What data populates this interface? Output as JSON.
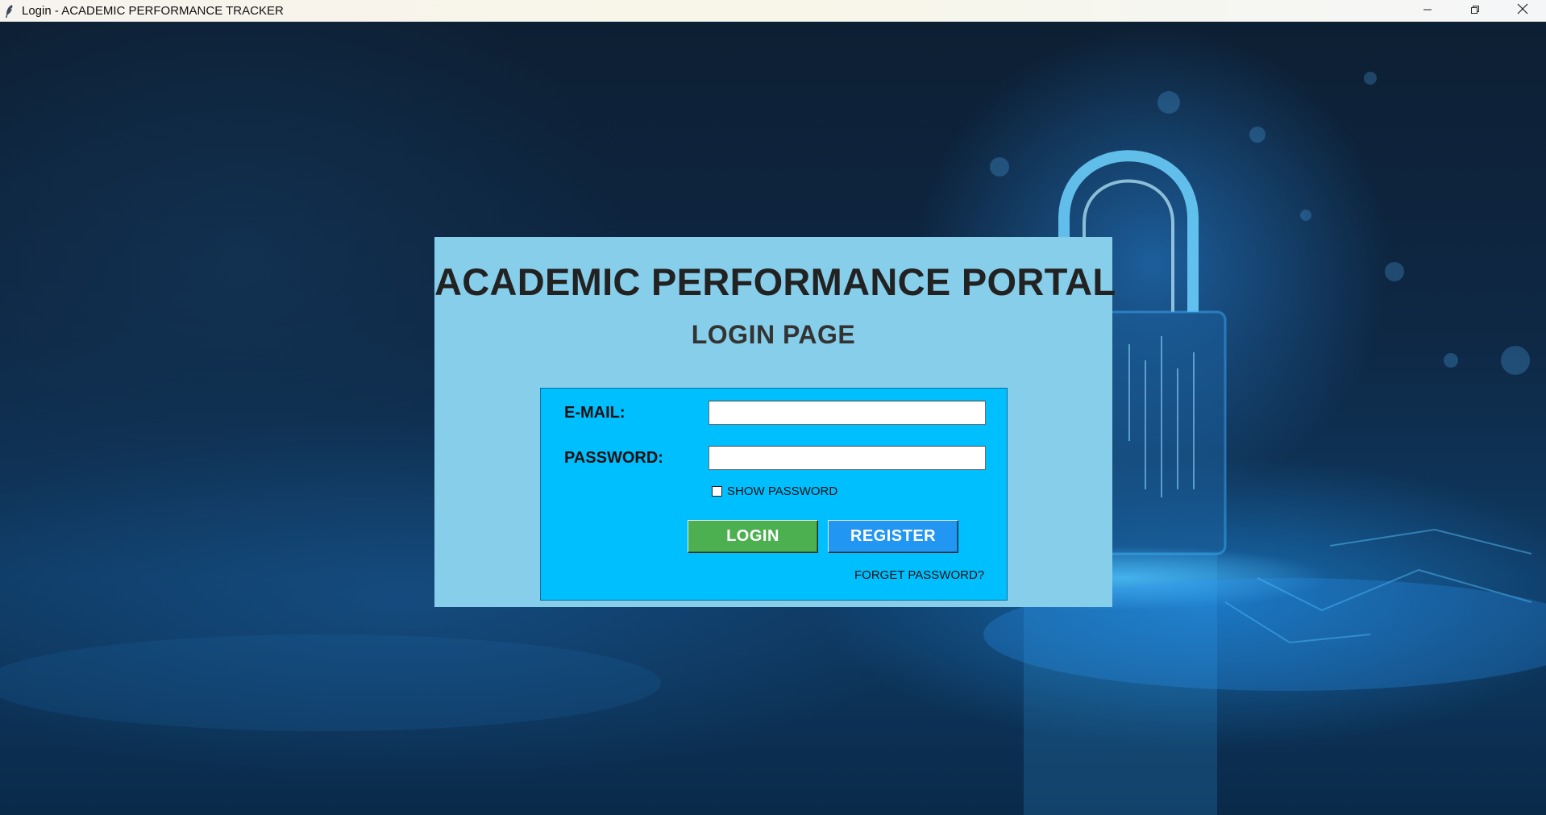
{
  "window": {
    "title": "Login - ACADEMIC PERFORMANCE TRACKER"
  },
  "icons": {
    "app": "feather-icon",
    "minimize": "minimize-icon",
    "restore": "restore-icon",
    "close": "close-icon",
    "background": "padlock-icon"
  },
  "card": {
    "title": "ACADEMIC PERFORMANCE PORTAL",
    "subtitle": "LOGIN PAGE"
  },
  "form": {
    "email_label": "E-MAIL:",
    "email_value": "",
    "password_label": "PASSWORD:",
    "password_value": "",
    "show_password_label": "SHOW PASSWORD",
    "show_password_checked": false,
    "login_label": "LOGIN",
    "register_label": "REGISTER",
    "forget_password_label": "FORGET PASSWORD?"
  },
  "colors": {
    "card_background": "#87ceeb",
    "form_background": "#00bfff",
    "login_button": "#4caf50",
    "register_button": "#2196f3"
  }
}
